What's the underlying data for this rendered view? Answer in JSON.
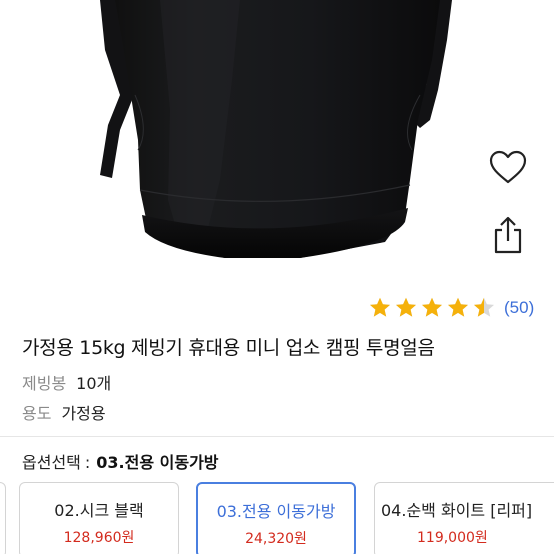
{
  "product": {
    "rating": 4.5,
    "review_count": "(50)",
    "title": "가정용 15kg 제빙기 휴대용 미니 업소 캠핑 투명얼음",
    "specs": [
      {
        "key": "제빙봉",
        "value": "10개"
      },
      {
        "key": "용도",
        "value": "가정용"
      }
    ]
  },
  "actions": {
    "favorite_icon": "heart-outline-icon",
    "share_icon": "share-icon"
  },
  "option_selection": {
    "label": "옵션선택",
    "separator": ":",
    "selected": "03.전용 이동가방"
  },
  "options": [
    {
      "name": "",
      "price": ""
    },
    {
      "name": "02.시크 블랙",
      "price": "128,960원"
    },
    {
      "name": "03.전용 이동가방",
      "price": "24,320원",
      "selected": true
    },
    {
      "name": "04.순백 화이트 [리퍼]",
      "price": "119,000원"
    }
  ],
  "colors": {
    "accent": "#3d6fd8",
    "selected_border": "#4a7fe0",
    "price": "#d32b1e",
    "star": "#f5b10b"
  }
}
